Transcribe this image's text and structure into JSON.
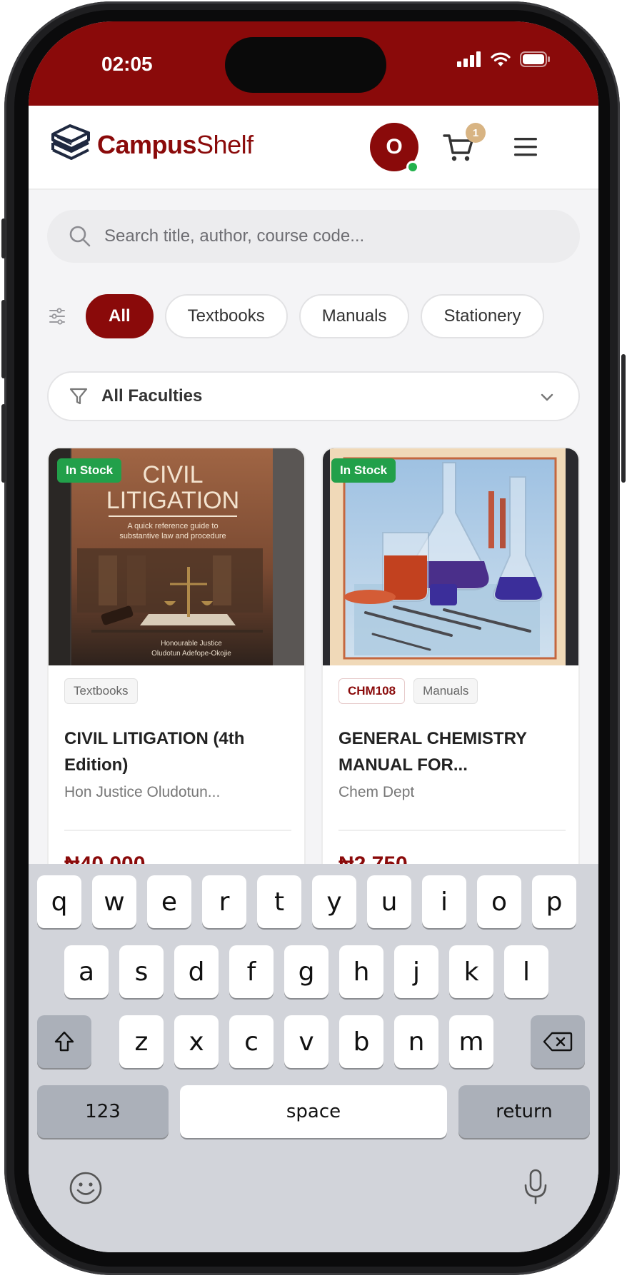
{
  "status": {
    "time": "02:05"
  },
  "header": {
    "brand_bold": "Campus",
    "brand_light": "Shelf",
    "avatar_initial": "O",
    "cart_count": "1",
    "accent": "#8a0a0a"
  },
  "search": {
    "placeholder": "Search title, author, course code..."
  },
  "categories": [
    "All",
    "Textbooks",
    "Manuals",
    "Stationery"
  ],
  "faculty_filter": {
    "selected": "All Faculties"
  },
  "products": [
    {
      "badge": "In Stock",
      "tags": [
        "Textbooks"
      ],
      "title": "CIVIL LITIGATION (4th Edition)",
      "author": "Hon Justice Oludotun...",
      "price": "₦40,000",
      "cover": {
        "heading1": "CIVIL",
        "heading2": "LITIGATION",
        "sub1": "A quick reference guide to",
        "sub2": "substantive law and procedure",
        "credit1": "Honourable Justice",
        "credit2": "Oludotun Adefope-Okojie"
      }
    },
    {
      "badge": "In Stock",
      "tags": [
        "CHM108",
        "Manuals"
      ],
      "title": "GENERAL CHEMISTRY MANUAL FOR...",
      "author": "Chem Dept",
      "price": "₦2,750"
    }
  ],
  "keyboard": {
    "row1": [
      "q",
      "w",
      "e",
      "r",
      "t",
      "y",
      "u",
      "i",
      "o",
      "p"
    ],
    "row2": [
      "a",
      "s",
      "d",
      "f",
      "g",
      "h",
      "j",
      "k",
      "l"
    ],
    "row3": [
      "z",
      "x",
      "c",
      "v",
      "b",
      "n",
      "m"
    ],
    "numbers_label": "123",
    "space_label": "space",
    "return_label": "return"
  }
}
